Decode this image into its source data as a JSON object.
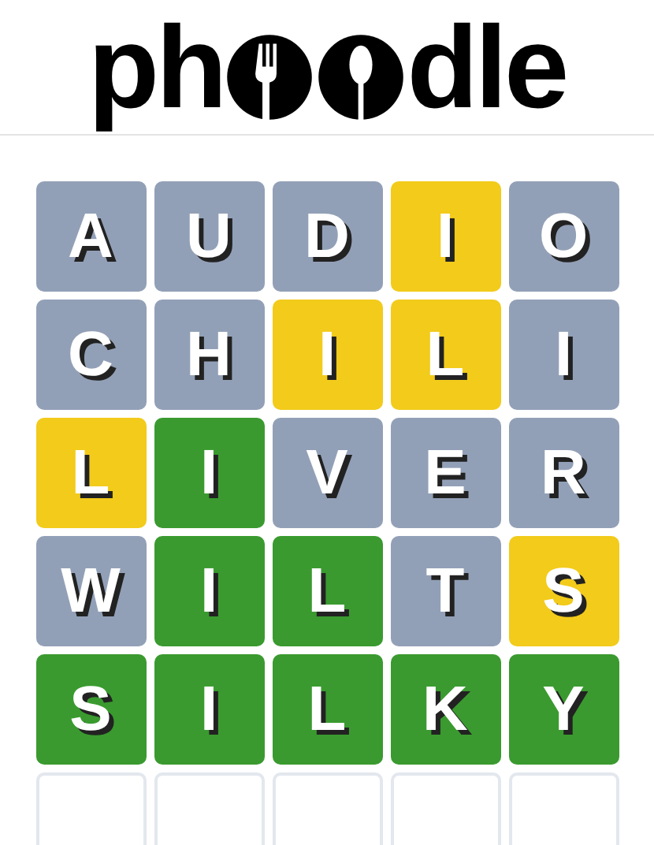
{
  "logo": {
    "before": "ph",
    "after": "dle"
  },
  "rows": [
    {
      "tiles": [
        {
          "letter": "A",
          "color": "#92a0b7"
        },
        {
          "letter": "U",
          "color": "#92a0b7"
        },
        {
          "letter": "D",
          "color": "#92a0b7"
        },
        {
          "letter": "I",
          "color": "#f2cb1b"
        },
        {
          "letter": "O",
          "color": "#92a0b7"
        }
      ]
    },
    {
      "tiles": [
        {
          "letter": "C",
          "color": "#92a0b7"
        },
        {
          "letter": "H",
          "color": "#92a0b7"
        },
        {
          "letter": "I",
          "color": "#f2cb1b"
        },
        {
          "letter": "L",
          "color": "#f2cb1b"
        },
        {
          "letter": "I",
          "color": "#92a0b7"
        }
      ]
    },
    {
      "tiles": [
        {
          "letter": "L",
          "color": "#f2cb1b"
        },
        {
          "letter": "I",
          "color": "#3a9a2f"
        },
        {
          "letter": "V",
          "color": "#92a0b7"
        },
        {
          "letter": "E",
          "color": "#92a0b7"
        },
        {
          "letter": "R",
          "color": "#92a0b7"
        }
      ]
    },
    {
      "tiles": [
        {
          "letter": "W",
          "color": "#92a0b7"
        },
        {
          "letter": "I",
          "color": "#3a9a2f"
        },
        {
          "letter": "L",
          "color": "#3a9a2f"
        },
        {
          "letter": "T",
          "color": "#92a0b7"
        },
        {
          "letter": "S",
          "color": "#f2cb1b"
        }
      ]
    },
    {
      "tiles": [
        {
          "letter": "S",
          "color": "#3a9a2f"
        },
        {
          "letter": "I",
          "color": "#3a9a2f"
        },
        {
          "letter": "L",
          "color": "#3a9a2f"
        },
        {
          "letter": "K",
          "color": "#3a9a2f"
        },
        {
          "letter": "Y",
          "color": "#3a9a2f"
        }
      ]
    },
    {
      "tiles": [
        {
          "color": "#ffffff"
        },
        {
          "color": "#ffffff"
        },
        {
          "color": "#ffffff"
        },
        {
          "color": "#ffffff"
        },
        {
          "color": "#ffffff"
        }
      ]
    }
  ]
}
